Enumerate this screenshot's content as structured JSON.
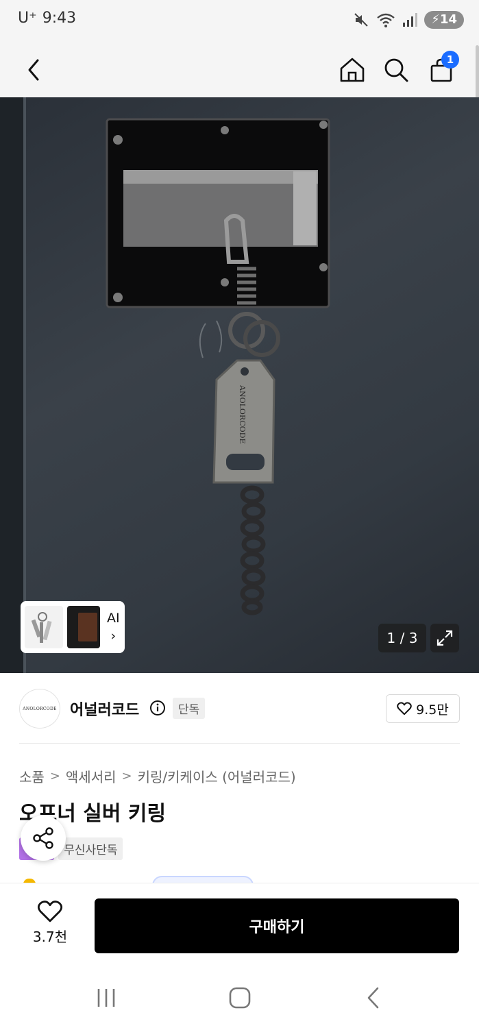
{
  "status_bar": {
    "carrier": "U⁺",
    "time": "9:43",
    "battery": "14"
  },
  "header": {
    "cart_badge": "1"
  },
  "gallery": {
    "ai_label": "AI",
    "ai_chevron": "›",
    "counter": "1 / 3",
    "photo_engraving": "ANOLORCODE"
  },
  "brand": {
    "logo_text": "ANOLORCODE",
    "name": "어널러코드",
    "exclusive_tag": "단독",
    "likes": "9.5만"
  },
  "breadcrumb": {
    "items": [
      "소품",
      "액세서리",
      "키링/키케이스 (어널러코드)"
    ],
    "separator": ">"
  },
  "product": {
    "title": "오프너 실버 키링",
    "tags": [
      "스타",
      "무신사단독"
    ]
  },
  "purchase_bar": {
    "wish_count": "3.7천",
    "buy_label": "구매하기"
  },
  "icons": {
    "back": "chevron-left-icon",
    "home": "home-icon",
    "search": "search-icon",
    "cart": "shopping-bag-icon",
    "info": "info-icon",
    "heart": "heart-icon",
    "share": "share-icon",
    "expand": "expand-icon"
  },
  "colors": {
    "accent_blue": "#1a6cff",
    "tag_purple": "#b271e6",
    "buy_button": "#000000"
  }
}
